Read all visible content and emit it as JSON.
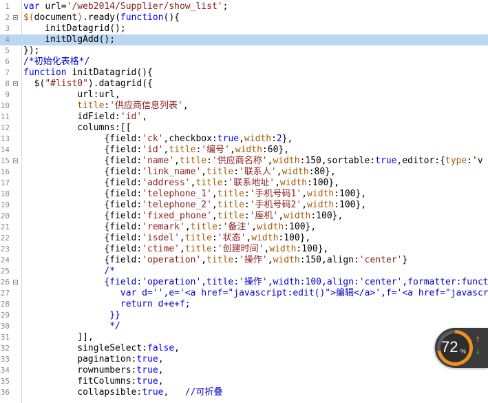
{
  "editor": {
    "lines": [
      {
        "n": "1",
        "spans": [
          [
            "kw",
            "var "
          ],
          [
            "",
            "url="
          ],
          [
            "str",
            "'/web2014/Supplier/show_list'"
          ],
          [
            "",
            ";"
          ]
        ]
      },
      {
        "n": "2",
        "fold": true,
        "spans": [
          [
            "prop",
            "$("
          ],
          [
            "",
            "document"
          ],
          [
            "prop",
            ")"
          ],
          [
            "",
            ".ready("
          ],
          [
            "kw",
            "function"
          ],
          [
            "",
            "(){"
          ]
        ]
      },
      {
        "n": "3",
        "spans": [
          [
            "",
            "    initDatagrid();"
          ]
        ]
      },
      {
        "n": "4",
        "hl": true,
        "spans": [
          [
            "",
            "    initDlgAdd();"
          ]
        ]
      },
      {
        "n": "5",
        "spans": [
          [
            "",
            "});"
          ]
        ]
      },
      {
        "n": "6",
        "spans": [
          [
            "cmt",
            "/*初始化表格*/"
          ]
        ]
      },
      {
        "n": "7",
        "spans": [
          [
            "kw",
            "function "
          ],
          [
            "",
            "initDatagrid(){"
          ]
        ]
      },
      {
        "n": "8",
        "fold": true,
        "spans": [
          [
            "",
            "  $("
          ],
          [
            "str",
            "\"#list0\""
          ],
          [
            "",
            ").datagrid({"
          ]
        ]
      },
      {
        "n": "9",
        "spans": [
          [
            "",
            "          url:url,"
          ]
        ]
      },
      {
        "n": "10",
        "spans": [
          [
            "prop",
            "          title"
          ],
          [
            "",
            ":"
          ],
          [
            "str",
            "'供应商信息列表'"
          ],
          [
            "",
            ","
          ]
        ]
      },
      {
        "n": "11",
        "spans": [
          [
            "",
            "          idField:"
          ],
          [
            "str",
            "'id'"
          ],
          [
            "",
            ","
          ]
        ]
      },
      {
        "n": "12",
        "spans": [
          [
            "",
            "          columns:[["
          ]
        ]
      },
      {
        "n": "13",
        "spans": [
          [
            "",
            "               {field:"
          ],
          [
            "str",
            "'ck'"
          ],
          [
            "",
            ",checkbox:"
          ],
          [
            "kw",
            "true"
          ],
          [
            "",
            ","
          ],
          [
            "prop",
            "width"
          ],
          [
            "",
            ":"
          ],
          [
            "kw",
            "2"
          ],
          [
            "",
            "},"
          ]
        ]
      },
      {
        "n": "14",
        "spans": [
          [
            "",
            "               {field:"
          ],
          [
            "str",
            "'id'"
          ],
          [
            "",
            ","
          ],
          [
            "prop",
            "title"
          ],
          [
            "",
            ":"
          ],
          [
            "str",
            "'编号'"
          ],
          [
            "",
            ","
          ],
          [
            "prop",
            "width"
          ],
          [
            "",
            ":60},"
          ]
        ]
      },
      {
        "n": "15",
        "fold": true,
        "spans": [
          [
            "",
            "               {field:"
          ],
          [
            "str",
            "'name'"
          ],
          [
            "",
            ","
          ],
          [
            "prop",
            "title"
          ],
          [
            "",
            ":"
          ],
          [
            "str",
            "'供应商名称'"
          ],
          [
            "",
            ","
          ],
          [
            "prop",
            "width"
          ],
          [
            "",
            ":150,sortable:"
          ],
          [
            "kw",
            "true"
          ],
          [
            "",
            ",editor:{"
          ],
          [
            "prop",
            "type"
          ],
          [
            "",
            ":'v"
          ]
        ]
      },
      {
        "n": "16",
        "spans": [
          [
            "",
            "               {field:"
          ],
          [
            "str",
            "'link_name'"
          ],
          [
            "",
            ","
          ],
          [
            "prop",
            "title"
          ],
          [
            "",
            ":"
          ],
          [
            "str",
            "'联系人'"
          ],
          [
            "",
            ","
          ],
          [
            "prop",
            "width"
          ],
          [
            "",
            ":80},"
          ]
        ]
      },
      {
        "n": "17",
        "spans": [
          [
            "",
            "               {field:"
          ],
          [
            "str",
            "'address'"
          ],
          [
            "",
            ","
          ],
          [
            "prop",
            "title"
          ],
          [
            "",
            ":"
          ],
          [
            "str",
            "'联系地址'"
          ],
          [
            "",
            ","
          ],
          [
            "prop",
            "width"
          ],
          [
            "",
            ":100},"
          ]
        ]
      },
      {
        "n": "18",
        "spans": [
          [
            "",
            "               {field:"
          ],
          [
            "str",
            "'telephone_1'"
          ],
          [
            "",
            ","
          ],
          [
            "prop",
            "title"
          ],
          [
            "",
            ":"
          ],
          [
            "str",
            "'手机号码1'"
          ],
          [
            "",
            ","
          ],
          [
            "prop",
            "width"
          ],
          [
            "",
            ":100},"
          ]
        ]
      },
      {
        "n": "19",
        "spans": [
          [
            "",
            "               {field:"
          ],
          [
            "str",
            "'telephone_2'"
          ],
          [
            "",
            ","
          ],
          [
            "prop",
            "title"
          ],
          [
            "",
            ":"
          ],
          [
            "str",
            "'手机号码2'"
          ],
          [
            "",
            ","
          ],
          [
            "prop",
            "width"
          ],
          [
            "",
            ":100},"
          ]
        ]
      },
      {
        "n": "20",
        "spans": [
          [
            "",
            "               {field:"
          ],
          [
            "str",
            "'fixed_phone'"
          ],
          [
            "",
            ","
          ],
          [
            "prop",
            "title"
          ],
          [
            "",
            ":"
          ],
          [
            "str",
            "'座机'"
          ],
          [
            "",
            ","
          ],
          [
            "prop",
            "width"
          ],
          [
            "",
            ":100},"
          ]
        ]
      },
      {
        "n": "21",
        "spans": [
          [
            "",
            "               {field:"
          ],
          [
            "str",
            "'remark'"
          ],
          [
            "",
            ","
          ],
          [
            "prop",
            "title"
          ],
          [
            "",
            ":"
          ],
          [
            "str",
            "'备注'"
          ],
          [
            "",
            ","
          ],
          [
            "prop",
            "width"
          ],
          [
            "",
            ":100},"
          ]
        ]
      },
      {
        "n": "22",
        "spans": [
          [
            "",
            "               {field:"
          ],
          [
            "str",
            "'isdel'"
          ],
          [
            "",
            ","
          ],
          [
            "prop",
            "title"
          ],
          [
            "",
            ":"
          ],
          [
            "str",
            "'状态'"
          ],
          [
            "",
            ","
          ],
          [
            "prop",
            "width"
          ],
          [
            "",
            ":100},"
          ]
        ]
      },
      {
        "n": "23",
        "spans": [
          [
            "",
            "               {field:"
          ],
          [
            "str",
            "'ctime'"
          ],
          [
            "",
            ","
          ],
          [
            "prop",
            "title"
          ],
          [
            "",
            ":"
          ],
          [
            "str",
            "'创建时间'"
          ],
          [
            "",
            ","
          ],
          [
            "prop",
            "width"
          ],
          [
            "",
            ":100},"
          ]
        ]
      },
      {
        "n": "24",
        "spans": [
          [
            "",
            "               {field:"
          ],
          [
            "str",
            "'operation'"
          ],
          [
            "",
            ","
          ],
          [
            "prop",
            "title"
          ],
          [
            "",
            ":"
          ],
          [
            "str",
            "'操作'"
          ],
          [
            "",
            ","
          ],
          [
            "prop",
            "width"
          ],
          [
            "",
            ":150,align:"
          ],
          [
            "str",
            "'center'"
          ],
          [
            "",
            "}"
          ]
        ]
      },
      {
        "n": "25",
        "spans": [
          [
            "cmt",
            "               /*"
          ]
        ]
      },
      {
        "n": "26",
        "fold": true,
        "spans": [
          [
            "cmt",
            "               {field:'operation',title:'操作',width:100,align:'center',formatter:funct"
          ]
        ]
      },
      {
        "n": "27",
        "spans": [
          [
            "cmt",
            "                  var d='',e='<a href=\"javascript:edit()\">编辑</a>',f='<a href=\"javascri"
          ]
        ]
      },
      {
        "n": "28",
        "spans": [
          [
            "cmt",
            "                  return d+e+f;"
          ]
        ]
      },
      {
        "n": "29",
        "spans": [
          [
            "cmt",
            "                }}"
          ]
        ]
      },
      {
        "n": "30",
        "spans": [
          [
            "cmt",
            "                */"
          ]
        ]
      },
      {
        "n": "31",
        "spans": [
          [
            "",
            "          ]],"
          ]
        ]
      },
      {
        "n": "32",
        "spans": [
          [
            "",
            "          singleSelect:"
          ],
          [
            "kw",
            "false"
          ],
          [
            "",
            ","
          ]
        ]
      },
      {
        "n": "33",
        "spans": [
          [
            "",
            "          pagination:"
          ],
          [
            "kw",
            "true"
          ],
          [
            "",
            ","
          ]
        ]
      },
      {
        "n": "34",
        "spans": [
          [
            "",
            "          rownumbers:"
          ],
          [
            "kw",
            "true"
          ],
          [
            "",
            ","
          ]
        ]
      },
      {
        "n": "35",
        "spans": [
          [
            "",
            "          fitColumns:"
          ],
          [
            "kw",
            "true"
          ],
          [
            "",
            ","
          ]
        ]
      },
      {
        "n": "36",
        "spans": [
          [
            "",
            "          collapsible:"
          ],
          [
            "kw",
            "true"
          ],
          [
            "",
            ",   "
          ],
          [
            "cmt",
            "//可折叠"
          ]
        ]
      }
    ]
  },
  "gauge": {
    "value": "72",
    "unit": "%",
    "percent": 72,
    "colors": {
      "ring": "#f09020",
      "up_arrow": "#f0a020",
      "down_arrow": "#2ec060"
    },
    "icons": {
      "up": "up-arrow-icon",
      "down": "down-arrow-icon"
    }
  }
}
